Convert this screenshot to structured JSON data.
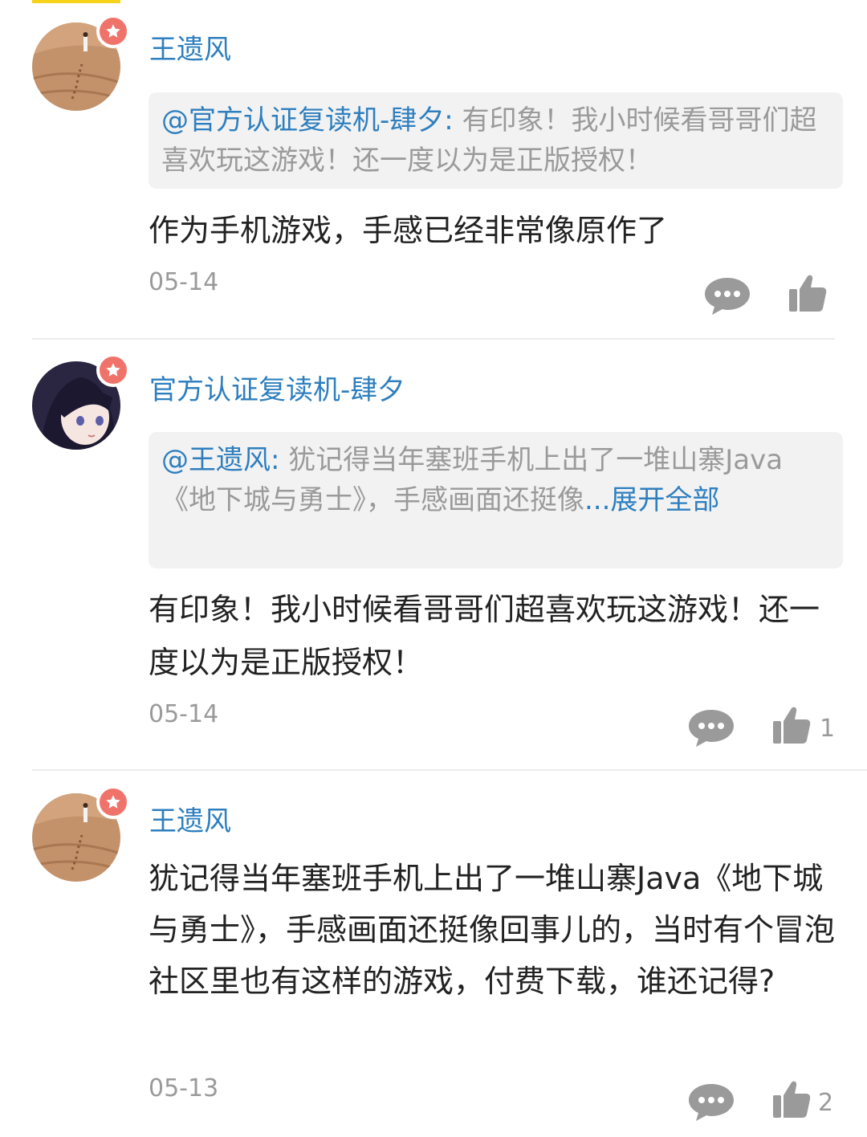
{
  "comments": [
    {
      "username": "王遗风",
      "quote_at": "@官方认证复读机-肆夕:",
      "quote_text": " 有印象！我小时候看哥哥们超喜欢玩这游戏！还一度以为是正版授权！",
      "body": "作为手机游戏，手感已经非常像原作了",
      "date": "05-14",
      "likes": ""
    },
    {
      "username": "官方认证复读机-肆夕",
      "quote_at": "@王遗风:",
      "quote_text": " 犹记得当年塞班手机上出了一堆山寨Java《地下城与勇士》，手感画面还挺像",
      "quote_more": "...展开全部",
      "body": "有印象！我小时候看哥哥们超喜欢玩这游戏！还一度以为是正版授权！",
      "date": "05-14",
      "likes": "1"
    },
    {
      "username": "王遗风",
      "body": "犹记得当年塞班手机上出了一堆山寨Java《地下城与勇士》，手感画面还挺像回事儿的，当时有个冒泡社区里也有这样的游戏，付费下载，谁还记得?",
      "date": "05-13",
      "likes": "2"
    }
  ],
  "icons": {
    "reply": "speech-bubble-icon",
    "like": "thumbs-up-icon",
    "badge": "star-badge-icon"
  },
  "colors": {
    "username": "#2e7fbf",
    "badge": "#f0736b",
    "accent_bar": "#f7d21a",
    "icon_gray": "#9a9a9a"
  }
}
